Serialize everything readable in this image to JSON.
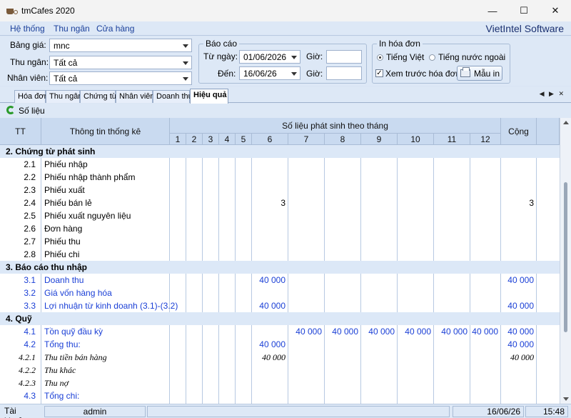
{
  "window": {
    "title": "tmCafes 2020",
    "minimize": "—",
    "maximize": "☐",
    "close": "✕"
  },
  "menu": {
    "items": [
      "Hệ thống",
      "Thu ngân",
      "Cửa hàng"
    ],
    "brand": "VietIntel Software"
  },
  "filters": {
    "price_label": "Bảng giá:",
    "price_value": "mnc",
    "cashier_label": "Thu ngân:",
    "cashier_value": "Tất cả",
    "staff_label": "Nhân viên:",
    "staff_value": "Tất cả",
    "report_group": "Báo cáo",
    "from_label": "Từ ngày:",
    "from_value": "01/06/2026",
    "to_label": "Đến:",
    "to_value": "16/06/26",
    "time_label": "Giờ:",
    "invoice_group": "In hóa đơn",
    "lang_vi": "Tiếng Việt",
    "lang_foreign": "Tiếng nước ngoài",
    "preview_label": "Xem trước hóa đơn",
    "template_button": "Mẫu in"
  },
  "tabs": [
    "Hóa đơn",
    "Thu ngân",
    "Chứng từ",
    "Nhân viên",
    "Doanh thu",
    "Hiệu quả"
  ],
  "active_tab": 5,
  "tabnav": "◀ ▶ ✕",
  "toolbar": {
    "refresh_label": "Số liệu"
  },
  "table": {
    "col_tt": "TT",
    "col_info": "Thông tin thống kê",
    "col_months_group": "Số liệu phát sinh theo tháng",
    "months": [
      "1",
      "2",
      "3",
      "4",
      "5",
      "6",
      "7",
      "8",
      "9",
      "10",
      "11",
      "12"
    ],
    "col_total": "Cộng",
    "rows": [
      {
        "type": "group",
        "tt": "",
        "name": "2. Chứng từ phát sinh",
        "m6": "",
        "m7": "",
        "m8": "",
        "m9": "",
        "m10": "",
        "m11": "",
        "m12": "",
        "total": ""
      },
      {
        "type": "row",
        "tt": "2.1",
        "name": "Phiếu nhập",
        "m6": "",
        "m7": "",
        "m8": "",
        "m9": "",
        "m10": "",
        "m11": "",
        "m12": "",
        "total": ""
      },
      {
        "type": "row",
        "tt": "2.2",
        "name": "Phiếu nhập thành phẩm",
        "m6": "",
        "m7": "",
        "m8": "",
        "m9": "",
        "m10": "",
        "m11": "",
        "m12": "",
        "total": ""
      },
      {
        "type": "row",
        "tt": "2.3",
        "name": "Phiếu xuất",
        "m6": "",
        "m7": "",
        "m8": "",
        "m9": "",
        "m10": "",
        "m11": "",
        "m12": "",
        "total": ""
      },
      {
        "type": "row",
        "tt": "2.4",
        "name": "Phiếu bán lẻ",
        "m6": "3",
        "m7": "",
        "m8": "",
        "m9": "",
        "m10": "",
        "m11": "",
        "m12": "",
        "total": "3"
      },
      {
        "type": "row",
        "tt": "2.5",
        "name": "Phiếu xuất nguyên liệu",
        "m6": "",
        "m7": "",
        "m8": "",
        "m9": "",
        "m10": "",
        "m11": "",
        "m12": "",
        "total": ""
      },
      {
        "type": "row",
        "tt": "2.6",
        "name": "Đơn hàng",
        "m6": "",
        "m7": "",
        "m8": "",
        "m9": "",
        "m10": "",
        "m11": "",
        "m12": "",
        "total": ""
      },
      {
        "type": "row",
        "tt": "2.7",
        "name": "Phiếu thu",
        "m6": "",
        "m7": "",
        "m8": "",
        "m9": "",
        "m10": "",
        "m11": "",
        "m12": "",
        "total": ""
      },
      {
        "type": "row",
        "tt": "2.8",
        "name": "Phiếu chi",
        "m6": "",
        "m7": "",
        "m8": "",
        "m9": "",
        "m10": "",
        "m11": "",
        "m12": "",
        "total": ""
      },
      {
        "type": "group",
        "tt": "",
        "name": "3. Báo cáo thu nhập",
        "m6": "",
        "m7": "",
        "m8": "",
        "m9": "",
        "m10": "",
        "m11": "",
        "m12": "",
        "total": ""
      },
      {
        "type": "blue",
        "tt": "3.1",
        "name": "Doanh thu",
        "m6": "40 000",
        "m7": "",
        "m8": "",
        "m9": "",
        "m10": "",
        "m11": "",
        "m12": "",
        "total": "40 000"
      },
      {
        "type": "blue",
        "tt": "3.2",
        "name": "Giá vốn hàng hóa",
        "m6": "",
        "m7": "",
        "m8": "",
        "m9": "",
        "m10": "",
        "m11": "",
        "m12": "",
        "total": ""
      },
      {
        "type": "blue",
        "tt": "3.3",
        "name": "Lợi nhuận từ kinh doanh (3.1)-(3.2)",
        "m6": "40 000",
        "m7": "",
        "m8": "",
        "m9": "",
        "m10": "",
        "m11": "",
        "m12": "",
        "total": "40 000"
      },
      {
        "type": "group",
        "tt": "",
        "name": "4. Quỹ",
        "m6": "",
        "m7": "",
        "m8": "",
        "m9": "",
        "m10": "",
        "m11": "",
        "m12": "",
        "total": ""
      },
      {
        "type": "blue",
        "tt": "4.1",
        "name": "Tồn quỹ đầu kỳ",
        "m6": "",
        "m7": "40 000",
        "m8": "40 000",
        "m9": "40 000",
        "m10": "40 000",
        "m11": "40 000",
        "m12": "40 000",
        "total": "40 000"
      },
      {
        "type": "blue",
        "tt": "4.2",
        "name": "Tổng thu:",
        "m6": "40 000",
        "m7": "",
        "m8": "",
        "m9": "",
        "m10": "",
        "m11": "",
        "m12": "",
        "total": "40 000"
      },
      {
        "type": "italic",
        "tt": "4.2.1",
        "name": "Thu tiền bán hàng",
        "m6": "40 000",
        "m7": "",
        "m8": "",
        "m9": "",
        "m10": "",
        "m11": "",
        "m12": "",
        "total": "40 000"
      },
      {
        "type": "italic",
        "tt": "4.2.2",
        "name": "Thu khác",
        "m6": "",
        "m7": "",
        "m8": "",
        "m9": "",
        "m10": "",
        "m11": "",
        "m12": "",
        "total": ""
      },
      {
        "type": "italic",
        "tt": "4.2.3",
        "name": "Thu nợ",
        "m6": "",
        "m7": "",
        "m8": "",
        "m9": "",
        "m10": "",
        "m11": "",
        "m12": "",
        "total": ""
      },
      {
        "type": "blue",
        "tt": "4.3",
        "name": "Tổng chi:",
        "m6": "",
        "m7": "",
        "m8": "",
        "m9": "",
        "m10": "",
        "m11": "",
        "m12": "",
        "total": ""
      }
    ]
  },
  "status": {
    "account_label": "Tài khoản:",
    "account_value": "admin",
    "date": "16/06/26",
    "time": "15:48"
  },
  "colors": {
    "header_bg": "#c9daf0",
    "group_bg": "#dce8f7",
    "link_blue": "#1a3fd6"
  }
}
